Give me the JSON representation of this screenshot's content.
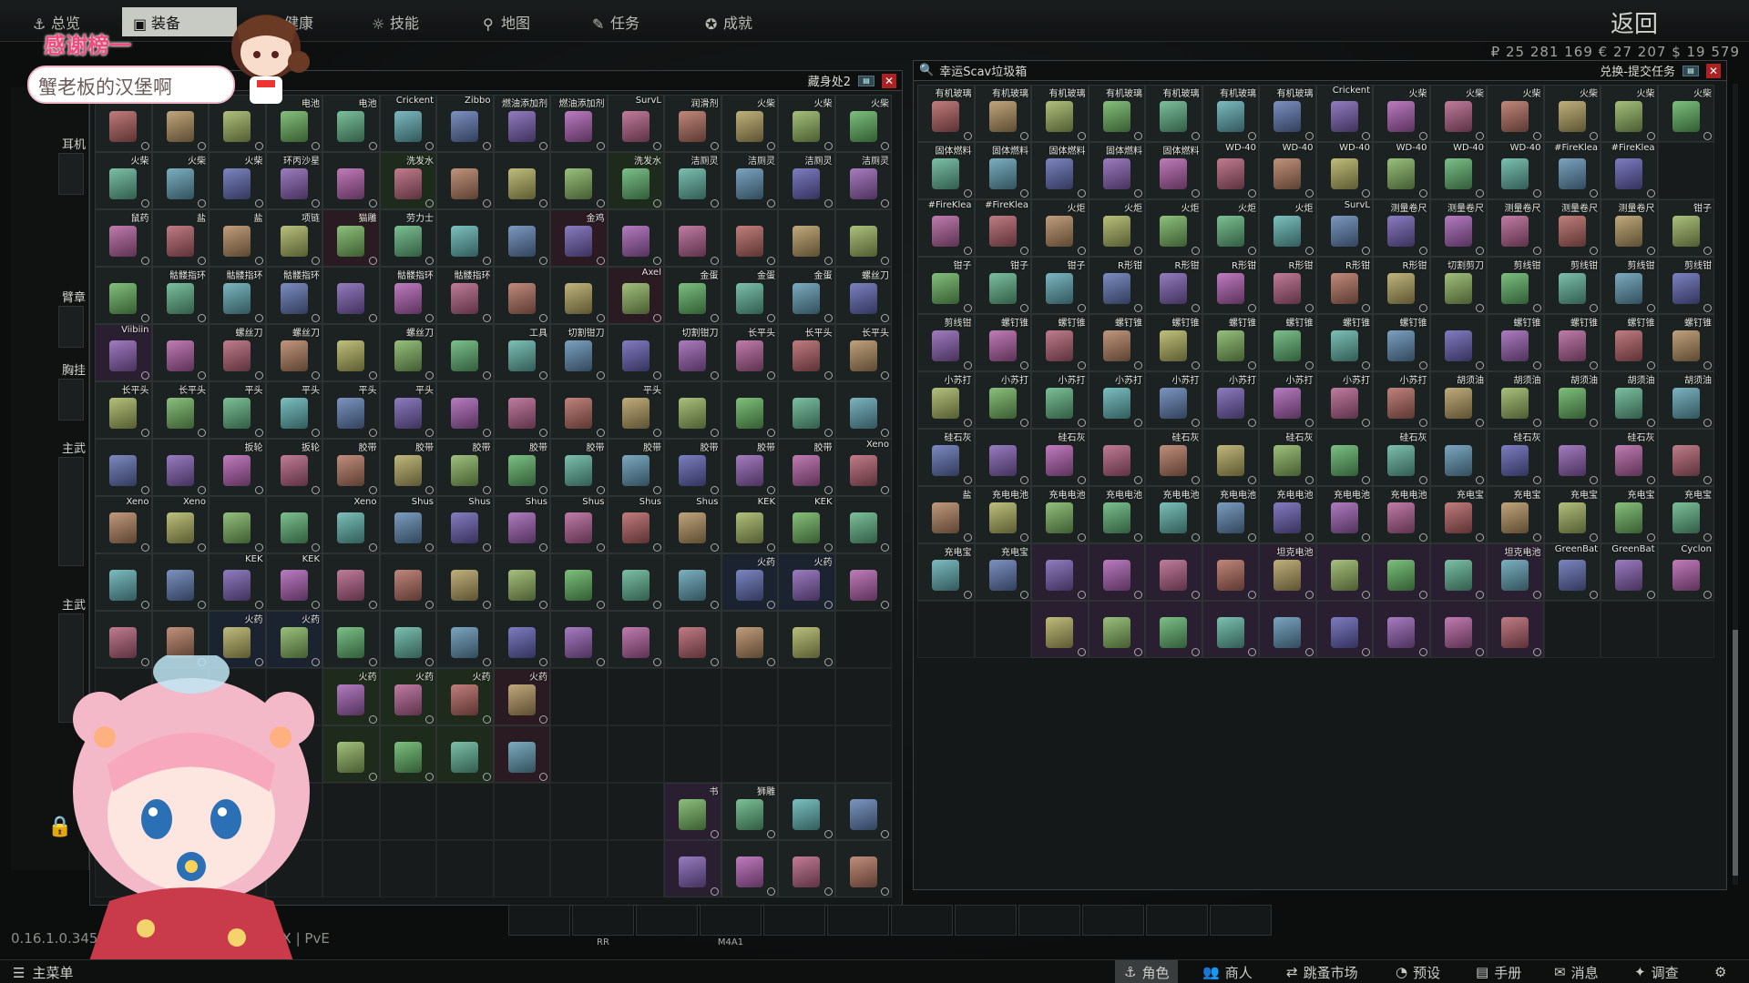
{
  "nav": {
    "tabs": [
      {
        "label": "总览"
      },
      {
        "label": "装备"
      },
      {
        "label": "健康"
      },
      {
        "label": "技能"
      },
      {
        "label": "地图"
      },
      {
        "label": "任务"
      },
      {
        "label": "成就"
      }
    ],
    "back": "返回",
    "money": "₽ 25 281 169   € 27 207   $ 19 579"
  },
  "overlay": {
    "banner": "感谢榜一",
    "bubble": "蟹老板的汉堡啊"
  },
  "sidebar": {
    "labels": [
      "耳机",
      "臂章",
      "胸挂",
      "主武",
      "主武"
    ]
  },
  "left_window": {
    "title": "藏身处2",
    "cols": 14,
    "cells": [
      {
        "l": "",
        "c": ""
      },
      {
        "l": "",
        "c": ""
      },
      {
        "l": "",
        "c": ""
      },
      {
        "l": "电池",
        "c": ""
      },
      {
        "l": "电池",
        "c": ""
      },
      {
        "l": "Crickent",
        "c": ""
      },
      {
        "l": "Zibbo",
        "c": ""
      },
      {
        "l": "燃油添加剂",
        "c": ""
      },
      {
        "l": "燃油添加剂",
        "c": ""
      },
      {
        "l": "SurvL",
        "c": ""
      },
      {
        "l": "润滑剂",
        "c": ""
      },
      {
        "l": "火柴",
        "c": ""
      },
      {
        "l": "火柴",
        "c": ""
      },
      {
        "l": "火柴",
        "c": ""
      },
      {
        "l": "火柴",
        "c": ""
      },
      {
        "l": "火柴",
        "c": ""
      },
      {
        "l": "火柴",
        "c": ""
      },
      {
        "l": "环丙沙星",
        "c": ""
      },
      {
        "l": "",
        "c": ""
      },
      {
        "l": "洗发水",
        "c": "green"
      },
      {
        "l": "",
        "c": ""
      },
      {
        "l": "",
        "c": ""
      },
      {
        "l": "",
        "c": ""
      },
      {
        "l": "洗发水",
        "c": "green"
      },
      {
        "l": "洁厕灵",
        "c": ""
      },
      {
        "l": "洁厕灵",
        "c": ""
      },
      {
        "l": "洁厕灵",
        "c": ""
      },
      {
        "l": "洁厕灵",
        "c": ""
      },
      {
        "l": "鼠药",
        "c": ""
      },
      {
        "l": "盐",
        "c": ""
      },
      {
        "l": "盐",
        "c": ""
      },
      {
        "l": "项链",
        "c": ""
      },
      {
        "l": "猫雕",
        "c": "red"
      },
      {
        "l": "劳力士",
        "c": ""
      },
      {
        "l": "",
        "c": ""
      },
      {
        "l": "",
        "c": ""
      },
      {
        "l": "金鸡",
        "c": "red"
      },
      {
        "l": "",
        "c": ""
      },
      {
        "l": "",
        "c": ""
      },
      {
        "l": "",
        "c": ""
      },
      {
        "l": "",
        "c": ""
      },
      {
        "l": "",
        "c": ""
      },
      {
        "l": "",
        "c": ""
      },
      {
        "l": "骷髅指环",
        "c": ""
      },
      {
        "l": "骷髅指环",
        "c": ""
      },
      {
        "l": "骷髅指环",
        "c": ""
      },
      {
        "l": "",
        "c": ""
      },
      {
        "l": "骷髅指环",
        "c": ""
      },
      {
        "l": "骷髅指环",
        "c": ""
      },
      {
        "l": "",
        "c": ""
      },
      {
        "l": "",
        "c": ""
      },
      {
        "l": "Axel",
        "c": "red"
      },
      {
        "l": "金蛋",
        "c": ""
      },
      {
        "l": "金蛋",
        "c": ""
      },
      {
        "l": "金蛋",
        "c": ""
      },
      {
        "l": "螺丝刀",
        "c": ""
      },
      {
        "l": "Viibiin",
        "c": "violet"
      },
      {
        "l": "",
        "c": ""
      },
      {
        "l": "螺丝刀",
        "c": ""
      },
      {
        "l": "螺丝刀",
        "c": ""
      },
      {
        "l": "",
        "c": ""
      },
      {
        "l": "螺丝刀",
        "c": ""
      },
      {
        "l": "",
        "c": ""
      },
      {
        "l": "工具",
        "c": ""
      },
      {
        "l": "切割钳刀",
        "c": ""
      },
      {
        "l": "",
        "c": ""
      },
      {
        "l": "切割钳刀",
        "c": ""
      },
      {
        "l": "长平头",
        "c": ""
      },
      {
        "l": "长平头",
        "c": ""
      },
      {
        "l": "长平头",
        "c": ""
      },
      {
        "l": "长平头",
        "c": ""
      },
      {
        "l": "长平头",
        "c": ""
      },
      {
        "l": "平头",
        "c": ""
      },
      {
        "l": "平头",
        "c": ""
      },
      {
        "l": "平头",
        "c": ""
      },
      {
        "l": "平头",
        "c": ""
      },
      {
        "l": "",
        "c": ""
      },
      {
        "l": "",
        "c": ""
      },
      {
        "l": "",
        "c": ""
      },
      {
        "l": "平头",
        "c": ""
      },
      {
        "l": "",
        "c": ""
      },
      {
        "l": "",
        "c": ""
      },
      {
        "l": "",
        "c": ""
      },
      {
        "l": "",
        "c": ""
      },
      {
        "l": "",
        "c": ""
      },
      {
        "l": "",
        "c": ""
      },
      {
        "l": "扳轮",
        "c": ""
      },
      {
        "l": "扳轮",
        "c": ""
      },
      {
        "l": "胶带",
        "c": ""
      },
      {
        "l": "胶带",
        "c": ""
      },
      {
        "l": "胶带",
        "c": ""
      },
      {
        "l": "胶带",
        "c": ""
      },
      {
        "l": "胶带",
        "c": ""
      },
      {
        "l": "胶带",
        "c": ""
      },
      {
        "l": "胶带",
        "c": ""
      },
      {
        "l": "胶带",
        "c": ""
      },
      {
        "l": "胶带",
        "c": ""
      },
      {
        "l": "Xeno",
        "c": ""
      },
      {
        "l": "Xeno",
        "c": ""
      },
      {
        "l": "Xeno",
        "c": ""
      },
      {
        "l": "",
        "c": ""
      },
      {
        "l": "",
        "c": ""
      },
      {
        "l": "Xeno",
        "c": ""
      },
      {
        "l": "Shus",
        "c": ""
      },
      {
        "l": "Shus",
        "c": ""
      },
      {
        "l": "Shus",
        "c": ""
      },
      {
        "l": "Shus",
        "c": ""
      },
      {
        "l": "Shus",
        "c": ""
      },
      {
        "l": "Shus",
        "c": ""
      },
      {
        "l": "KEK",
        "c": ""
      },
      {
        "l": "KEK",
        "c": ""
      },
      {
        "l": "",
        "c": ""
      },
      {
        "l": "",
        "c": ""
      },
      {
        "l": "",
        "c": ""
      },
      {
        "l": "KEK",
        "c": ""
      },
      {
        "l": "KEK",
        "c": ""
      },
      {
        "l": "",
        "c": ""
      },
      {
        "l": "",
        "c": ""
      },
      {
        "l": "",
        "c": ""
      },
      {
        "l": "",
        "c": ""
      },
      {
        "l": "",
        "c": ""
      },
      {
        "l": "",
        "c": ""
      },
      {
        "l": "",
        "c": ""
      },
      {
        "l": "火药",
        "c": "blue"
      },
      {
        "l": "火药",
        "c": "blue"
      },
      {
        "l": "",
        "c": ""
      },
      {
        "l": "",
        "c": ""
      },
      {
        "l": "",
        "c": ""
      },
      {
        "l": "火药",
        "c": "blue"
      },
      {
        "l": "火药",
        "c": "blue"
      },
      {
        "l": "",
        "c": ""
      },
      {
        "l": "",
        "c": ""
      },
      {
        "l": "",
        "c": ""
      },
      {
        "l": "",
        "c": ""
      },
      {
        "l": "",
        "c": ""
      },
      {
        "l": "",
        "c": ""
      },
      {
        "l": "",
        "c": ""
      },
      {
        "l": "",
        "c": ""
      },
      {
        "l": "",
        "c": ""
      },
      {
        "l": "",
        "c": "empty"
      },
      {
        "l": "",
        "c": "empty"
      },
      {
        "l": "",
        "c": "empty"
      },
      {
        "l": "",
        "c": "empty"
      },
      {
        "l": "",
        "c": "empty"
      },
      {
        "l": "火药",
        "c": "green"
      },
      {
        "l": "火药",
        "c": "green"
      },
      {
        "l": "火药",
        "c": "green"
      },
      {
        "l": "火药",
        "c": "red"
      },
      {
        "l": "",
        "c": "empty"
      },
      {
        "l": "",
        "c": "empty"
      },
      {
        "l": "",
        "c": "empty"
      },
      {
        "l": "",
        "c": "empty"
      },
      {
        "l": "",
        "c": "empty"
      },
      {
        "l": "",
        "c": "empty"
      },
      {
        "l": "",
        "c": "empty"
      },
      {
        "l": "",
        "c": "empty"
      },
      {
        "l": "",
        "c": "empty"
      },
      {
        "l": "",
        "c": "empty"
      },
      {
        "l": "",
        "c": "green"
      },
      {
        "l": "",
        "c": "green"
      },
      {
        "l": "",
        "c": "green"
      },
      {
        "l": "",
        "c": "red"
      },
      {
        "l": "",
        "c": "empty"
      },
      {
        "l": "",
        "c": "empty"
      },
      {
        "l": "",
        "c": "empty"
      },
      {
        "l": "",
        "c": "empty"
      },
      {
        "l": "",
        "c": "empty"
      },
      {
        "l": "",
        "c": "empty"
      },
      {
        "l": "",
        "c": "empty"
      },
      {
        "l": "",
        "c": "empty"
      },
      {
        "l": "",
        "c": "empty"
      },
      {
        "l": "",
        "c": "empty"
      },
      {
        "l": "",
        "c": "empty"
      },
      {
        "l": "",
        "c": "empty"
      },
      {
        "l": "",
        "c": "empty"
      },
      {
        "l": "",
        "c": "empty"
      },
      {
        "l": "",
        "c": "empty"
      },
      {
        "l": "",
        "c": "empty"
      },
      {
        "l": "书",
        "c": "violet"
      },
      {
        "l": "狮雕",
        "c": ""
      },
      {
        "l": "",
        "c": ""
      },
      {
        "l": "",
        "c": ""
      },
      {
        "l": "",
        "c": "empty"
      },
      {
        "l": "",
        "c": "empty"
      },
      {
        "l": "",
        "c": "empty"
      },
      {
        "l": "",
        "c": "empty"
      },
      {
        "l": "",
        "c": "empty"
      },
      {
        "l": "",
        "c": "empty"
      },
      {
        "l": "",
        "c": "empty"
      },
      {
        "l": "",
        "c": "empty"
      },
      {
        "l": "",
        "c": "empty"
      },
      {
        "l": "",
        "c": "empty"
      },
      {
        "l": "",
        "c": "violet"
      },
      {
        "l": "",
        "c": ""
      },
      {
        "l": "",
        "c": ""
      },
      {
        "l": "",
        "c": ""
      }
    ]
  },
  "right_window": {
    "title": "幸运Scav垃圾箱",
    "right_title": "兑换-提交任务",
    "cols": 14,
    "cells": [
      {
        "l": "有机玻璃",
        "c": ""
      },
      {
        "l": "有机玻璃",
        "c": ""
      },
      {
        "l": "有机玻璃",
        "c": ""
      },
      {
        "l": "有机玻璃",
        "c": ""
      },
      {
        "l": "有机玻璃",
        "c": ""
      },
      {
        "l": "有机玻璃",
        "c": ""
      },
      {
        "l": "有机玻璃",
        "c": ""
      },
      {
        "l": "Crickent",
        "c": ""
      },
      {
        "l": "火柴",
        "c": ""
      },
      {
        "l": "火柴",
        "c": ""
      },
      {
        "l": "火柴",
        "c": ""
      },
      {
        "l": "火柴",
        "c": ""
      },
      {
        "l": "火柴",
        "c": ""
      },
      {
        "l": "火柴",
        "c": ""
      },
      {
        "l": "固体燃料",
        "c": ""
      },
      {
        "l": "固体燃料",
        "c": ""
      },
      {
        "l": "固体燃料",
        "c": ""
      },
      {
        "l": "固体燃料",
        "c": ""
      },
      {
        "l": "固体燃料",
        "c": ""
      },
      {
        "l": "WD-40",
        "c": ""
      },
      {
        "l": "WD-40",
        "c": ""
      },
      {
        "l": "WD-40",
        "c": ""
      },
      {
        "l": "WD-40",
        "c": ""
      },
      {
        "l": "WD-40",
        "c": ""
      },
      {
        "l": "WD-40",
        "c": ""
      },
      {
        "l": "#FireKlea",
        "c": ""
      },
      {
        "l": "#FireKlea",
        "c": ""
      },
      {
        "l": "",
        "c": "empty"
      },
      {
        "l": "#FireKlea",
        "c": ""
      },
      {
        "l": "#FireKlea",
        "c": ""
      },
      {
        "l": "火炬",
        "c": ""
      },
      {
        "l": "火炬",
        "c": ""
      },
      {
        "l": "火炬",
        "c": ""
      },
      {
        "l": "火炬",
        "c": ""
      },
      {
        "l": "火炬",
        "c": ""
      },
      {
        "l": "SurvL",
        "c": ""
      },
      {
        "l": "测量卷尺",
        "c": ""
      },
      {
        "l": "测量卷尺",
        "c": ""
      },
      {
        "l": "测量卷尺",
        "c": ""
      },
      {
        "l": "测量卷尺",
        "c": ""
      },
      {
        "l": "测量卷尺",
        "c": ""
      },
      {
        "l": "钳子",
        "c": ""
      },
      {
        "l": "钳子",
        "c": ""
      },
      {
        "l": "钳子",
        "c": ""
      },
      {
        "l": "钳子",
        "c": ""
      },
      {
        "l": "R形钳",
        "c": ""
      },
      {
        "l": "R形钳",
        "c": ""
      },
      {
        "l": "R形钳",
        "c": ""
      },
      {
        "l": "R形钳",
        "c": ""
      },
      {
        "l": "R形钳",
        "c": ""
      },
      {
        "l": "R形钳",
        "c": ""
      },
      {
        "l": "切割剪刀",
        "c": ""
      },
      {
        "l": "剪线钳",
        "c": ""
      },
      {
        "l": "剪线钳",
        "c": ""
      },
      {
        "l": "剪线钳",
        "c": ""
      },
      {
        "l": "剪线钳",
        "c": ""
      },
      {
        "l": "剪线钳",
        "c": ""
      },
      {
        "l": "螺钉锥",
        "c": ""
      },
      {
        "l": "螺钉锥",
        "c": ""
      },
      {
        "l": "螺钉锥",
        "c": ""
      },
      {
        "l": "螺钉锥",
        "c": ""
      },
      {
        "l": "螺钉锥",
        "c": ""
      },
      {
        "l": "螺钉锥",
        "c": ""
      },
      {
        "l": "螺钉锥",
        "c": ""
      },
      {
        "l": "螺钉锥",
        "c": ""
      },
      {
        "l": "",
        "c": ""
      },
      {
        "l": "螺钉锥",
        "c": ""
      },
      {
        "l": "螺钉锥",
        "c": ""
      },
      {
        "l": "螺钉锥",
        "c": ""
      },
      {
        "l": "螺钉锥",
        "c": ""
      },
      {
        "l": "小苏打",
        "c": ""
      },
      {
        "l": "小苏打",
        "c": ""
      },
      {
        "l": "小苏打",
        "c": ""
      },
      {
        "l": "小苏打",
        "c": ""
      },
      {
        "l": "小苏打",
        "c": ""
      },
      {
        "l": "小苏打",
        "c": ""
      },
      {
        "l": "小苏打",
        "c": ""
      },
      {
        "l": "小苏打",
        "c": ""
      },
      {
        "l": "小苏打",
        "c": ""
      },
      {
        "l": "胡须油",
        "c": ""
      },
      {
        "l": "胡须油",
        "c": ""
      },
      {
        "l": "胡须油",
        "c": ""
      },
      {
        "l": "胡须油",
        "c": ""
      },
      {
        "l": "胡须油",
        "c": ""
      },
      {
        "l": "硅石灰",
        "c": ""
      },
      {
        "l": "",
        "c": ""
      },
      {
        "l": "硅石灰",
        "c": ""
      },
      {
        "l": "",
        "c": ""
      },
      {
        "l": "硅石灰",
        "c": ""
      },
      {
        "l": "",
        "c": ""
      },
      {
        "l": "硅石灰",
        "c": ""
      },
      {
        "l": "",
        "c": ""
      },
      {
        "l": "硅石灰",
        "c": ""
      },
      {
        "l": "",
        "c": ""
      },
      {
        "l": "硅石灰",
        "c": ""
      },
      {
        "l": "",
        "c": ""
      },
      {
        "l": "硅石灰",
        "c": ""
      },
      {
        "l": "",
        "c": ""
      },
      {
        "l": "盐",
        "c": ""
      },
      {
        "l": "充电电池",
        "c": ""
      },
      {
        "l": "充电电池",
        "c": ""
      },
      {
        "l": "充电电池",
        "c": ""
      },
      {
        "l": "充电电池",
        "c": ""
      },
      {
        "l": "充电电池",
        "c": ""
      },
      {
        "l": "充电电池",
        "c": ""
      },
      {
        "l": "充电电池",
        "c": ""
      },
      {
        "l": "充电电池",
        "c": ""
      },
      {
        "l": "充电宝",
        "c": ""
      },
      {
        "l": "充电宝",
        "c": ""
      },
      {
        "l": "充电宝",
        "c": ""
      },
      {
        "l": "充电宝",
        "c": ""
      },
      {
        "l": "充电宝",
        "c": ""
      },
      {
        "l": "充电宝",
        "c": ""
      },
      {
        "l": "充电宝",
        "c": ""
      },
      {
        "l": "",
        "c": "violet"
      },
      {
        "l": "",
        "c": "violet"
      },
      {
        "l": "",
        "c": "violet"
      },
      {
        "l": "",
        "c": "violet"
      },
      {
        "l": "坦克电池",
        "c": "violet"
      },
      {
        "l": "",
        "c": "violet"
      },
      {
        "l": "",
        "c": "violet"
      },
      {
        "l": "",
        "c": "violet"
      },
      {
        "l": "坦克电池",
        "c": "violet"
      },
      {
        "l": "GreenBat",
        "c": ""
      },
      {
        "l": "GreenBat",
        "c": ""
      },
      {
        "l": "Cyclon",
        "c": ""
      },
      {
        "l": "",
        "c": "empty"
      },
      {
        "l": "",
        "c": "empty"
      },
      {
        "l": "",
        "c": "violet"
      },
      {
        "l": "",
        "c": "violet"
      },
      {
        "l": "",
        "c": "violet"
      },
      {
        "l": "",
        "c": "violet"
      },
      {
        "l": "",
        "c": "violet"
      },
      {
        "l": "",
        "c": "violet"
      },
      {
        "l": "",
        "c": "violet"
      },
      {
        "l": "",
        "c": "violet"
      },
      {
        "l": "",
        "c": "violet"
      },
      {
        "l": "",
        "c": "empty"
      },
      {
        "l": "",
        "c": "empty"
      },
      {
        "l": "",
        "c": "empty"
      }
    ]
  },
  "version": "0.16.1.0.34561",
  "mode": "0X | PvE",
  "quick_slots": [
    "",
    "RR",
    "",
    "M4A1",
    "",
    "",
    "",
    "",
    "",
    "",
    "",
    ""
  ],
  "bottom": {
    "main_menu": "主菜单",
    "tabs": [
      {
        "label": "角色"
      },
      {
        "label": "商人"
      },
      {
        "label": "跳蚤市场"
      },
      {
        "label": "预设"
      },
      {
        "label": "手册"
      },
      {
        "label": "消息"
      },
      {
        "label": "调查"
      }
    ]
  },
  "colors": {
    "accent": "#c8cbc4",
    "close": "#aa2222",
    "highlight_violet": "#2a1f30"
  }
}
